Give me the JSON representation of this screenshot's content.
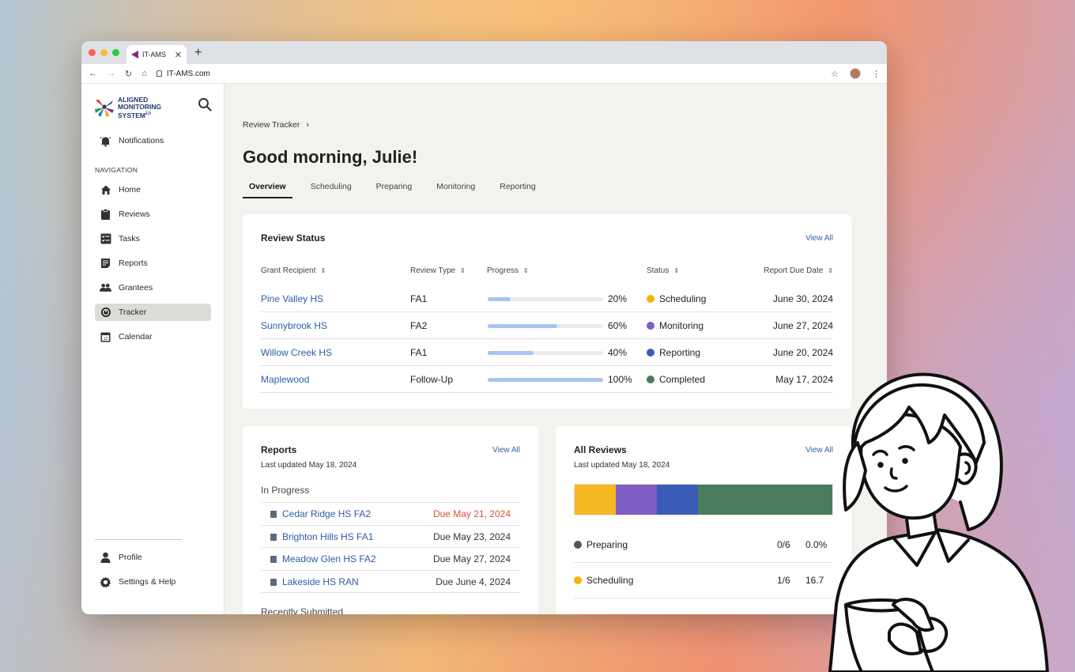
{
  "browser": {
    "tab_title": "IT-AMS",
    "url": "IT-AMS.com"
  },
  "logo": {
    "line1": "ALIGNED",
    "line2": "MONITORING",
    "line3": "SYSTEM",
    "version": "2.0"
  },
  "sidebar": {
    "notifications": "Notifications",
    "nav_heading": "NAVIGATION",
    "items": [
      {
        "label": "Home",
        "icon": "home-icon"
      },
      {
        "label": "Reviews",
        "icon": "clipboard-icon"
      },
      {
        "label": "Tasks",
        "icon": "checklist-icon"
      },
      {
        "label": "Reports",
        "icon": "report-icon"
      },
      {
        "label": "Grantees",
        "icon": "people-icon"
      },
      {
        "label": "Tracker",
        "icon": "tracker-icon",
        "active": true
      },
      {
        "label": "Calendar",
        "icon": "calendar-icon"
      }
    ],
    "profile": "Profile",
    "settings": "Settings & Help"
  },
  "main": {
    "breadcrumb": "Review Tracker",
    "greeting": "Good morning, Julie!",
    "tabs": [
      "Overview",
      "Scheduling",
      "Preparing",
      "Monitoring",
      "Reporting"
    ],
    "active_tab": "Overview"
  },
  "review_status": {
    "title": "Review Status",
    "view_all": "View All",
    "columns": [
      "Grant Recipient",
      "Review Type",
      "Progress",
      "Status",
      "Report Due Date"
    ],
    "rows": [
      {
        "recipient": "Pine Valley HS",
        "type": "FA1",
        "progress": 20,
        "progress_label": "20%",
        "status": "Scheduling",
        "status_color": "#f4b400",
        "due": "June 30, 2024"
      },
      {
        "recipient": "Sunnybrook HS",
        "type": "FA2",
        "progress": 60,
        "progress_label": "60%",
        "status": "Monitoring",
        "status_color": "#7e5ec2",
        "due": "June 27, 2024"
      },
      {
        "recipient": "Willow Creek HS",
        "type": "FA1",
        "progress": 40,
        "progress_label": "40%",
        "status": "Reporting",
        "status_color": "#3b5bb8",
        "due": "June 20, 2024"
      },
      {
        "recipient": "Maplewood",
        "type": "Follow-Up",
        "progress": 100,
        "progress_label": "100%",
        "status": "Completed",
        "status_color": "#4a7d5e",
        "due": "May 17, 2024"
      }
    ]
  },
  "reports": {
    "title": "Reports",
    "view_all": "View All",
    "updated": "Last updated May 18, 2024",
    "in_progress_label": "In Progress",
    "items": [
      {
        "name": "Cedar Ridge HS FA2",
        "due": "Due May 21, 2024",
        "late": true
      },
      {
        "name": "Brighton Hills HS FA1",
        "due": "Due May 23, 2024",
        "late": false
      },
      {
        "name": "Meadow Glen HS FA2",
        "due": "Due May 27, 2024",
        "late": false
      },
      {
        "name": "Lakeside HS RAN",
        "due": "Due June 4, 2024",
        "late": false
      }
    ],
    "recently_submitted_label": "Recently Submitted"
  },
  "all_reviews": {
    "title": "All Reviews",
    "view_all": "View All",
    "updated": "Last updated May 18, 2024",
    "stack_segments": [
      {
        "label": "Scheduling",
        "fraction": 0.16,
        "color": "#f6b821"
      },
      {
        "label": "Monitoring",
        "fraction": 0.16,
        "color": "#7e5ec2"
      },
      {
        "label": "Reporting",
        "fraction": 0.16,
        "color": "#3b5bb8"
      },
      {
        "label": "Completed",
        "fraction": 0.52,
        "color": "#4a7d5e"
      }
    ],
    "rows": [
      {
        "label": "Preparing",
        "color": "#555555",
        "count": "0/6",
        "pct": "0.0%"
      },
      {
        "label": "Scheduling",
        "color": "#f4b400",
        "count": "1/6",
        "pct": "16.7"
      }
    ]
  }
}
